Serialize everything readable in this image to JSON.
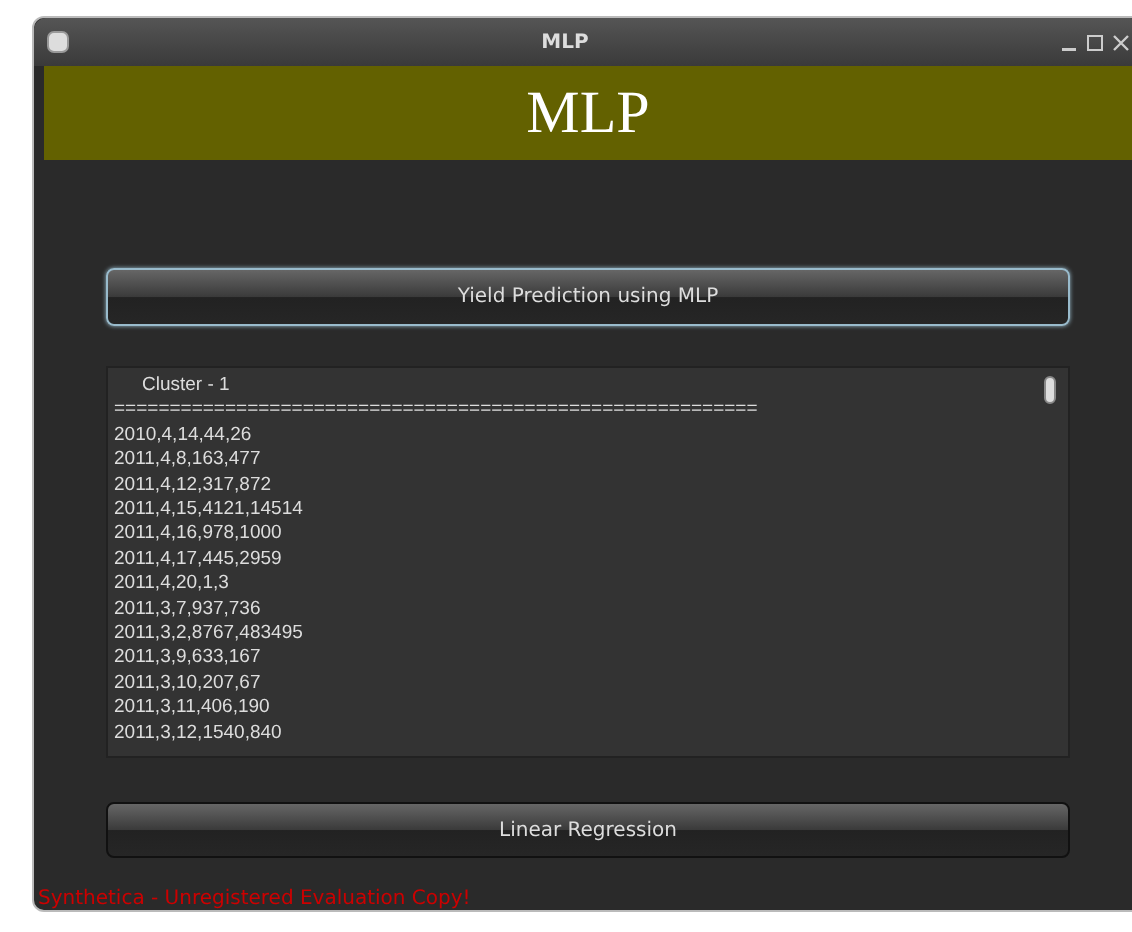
{
  "window": {
    "title": "MLP"
  },
  "banner": {
    "title": "MLP"
  },
  "buttons": [
    {
      "label": "Yield Prediction using MLP",
      "selected": true
    },
    {
      "label": "Linear Regression",
      "selected": false
    }
  ],
  "output": {
    "heading": "Cluster - 1",
    "separator": "==========================================================",
    "lines": [
      "2010,4,14,44,26",
      "2011,4,8,163,477",
      "2011,4,12,317,872",
      "2011,4,15,4121,14514",
      "2011,4,16,978,1000",
      "2011,4,17,445,2959",
      "2011,4,20,1,3",
      "2011,3,7,937,736",
      "2011,3,2,8767,483495",
      "2011,3,9,633,167",
      "2011,3,10,207,67",
      "2011,3,11,406,190",
      "2011,3,12,1540,840"
    ]
  },
  "status": {
    "text": "Synthetica - Unregistered Evaluation Copy!"
  }
}
